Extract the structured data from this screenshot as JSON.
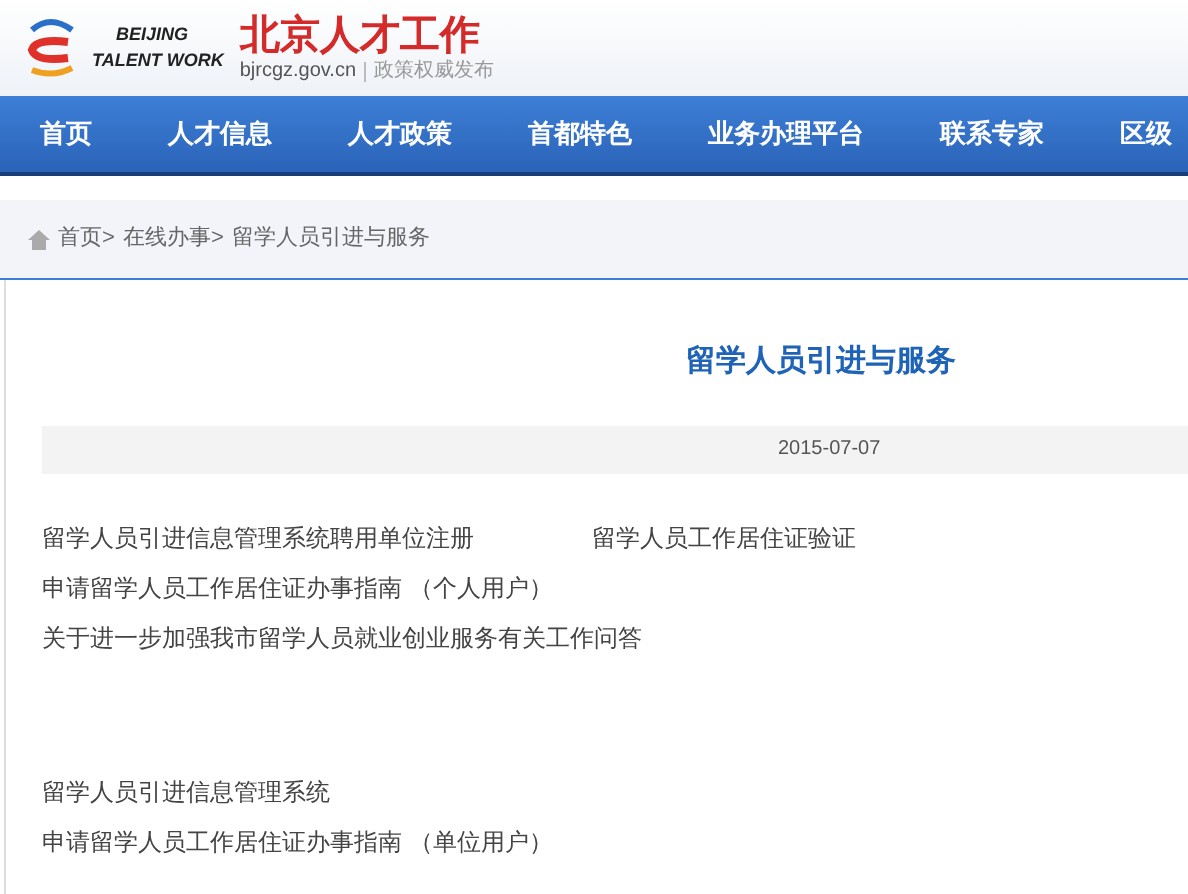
{
  "header": {
    "logo_line_1": "BEIJING",
    "logo_line_2": "TALENT WORK",
    "site_title": "北京人才工作",
    "domain": "bjrcgz.gov.cn",
    "tagline": "政策权威发布"
  },
  "nav": [
    {
      "label": "首页"
    },
    {
      "label": "人才信息"
    },
    {
      "label": "人才政策"
    },
    {
      "label": "首都特色"
    },
    {
      "label": "业务办理平台"
    },
    {
      "label": "联系专家"
    },
    {
      "label": "区级"
    }
  ],
  "breadcrumb": [
    "首页>",
    "在线办事>",
    "留学人员引进与服务"
  ],
  "article": {
    "title": "留学人员引进与服务",
    "date": "2015-07-07",
    "link_groups": [
      [
        [
          "留学人员引进信息管理系统聘用单位注册",
          "留学人员工作居住证验证"
        ],
        [
          "申请留学人员工作居住证办事指南 （个人用户）"
        ],
        [
          "关于进一步加强我市留学人员就业创业服务有关工作问答"
        ]
      ],
      [
        [
          "留学人员引进信息管理系统"
        ],
        [
          "申请留学人员工作居住证办事指南 （单位用户）"
        ]
      ]
    ]
  }
}
